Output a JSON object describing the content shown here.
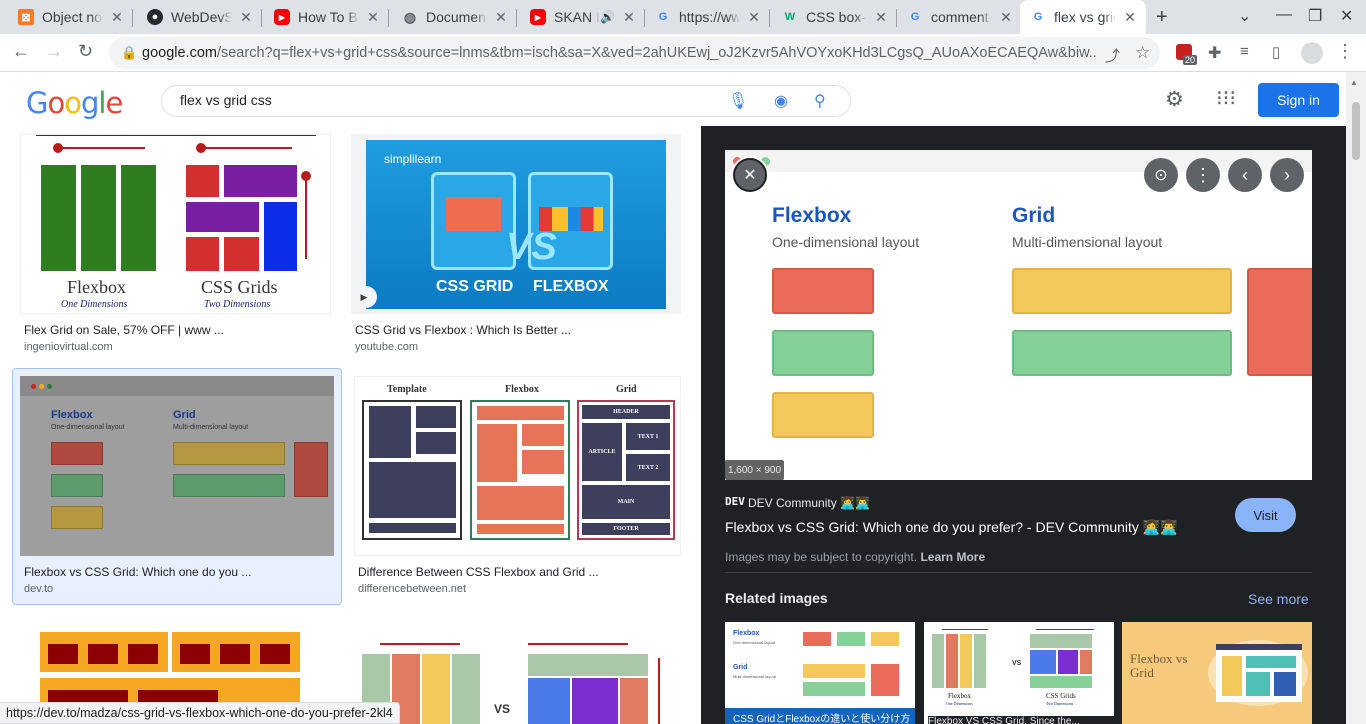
{
  "tabs": [
    {
      "title": "Object not found",
      "icon": "xampp-icon"
    },
    {
      "title": "WebDevSimplified",
      "icon": "github-icon"
    },
    {
      "title": "How To Build",
      "icon": "youtube-icon"
    },
    {
      "title": "Document",
      "icon": "globe-icon"
    },
    {
      "title": "SKAN I",
      "icon": "youtube-icon"
    },
    {
      "title": "https://www",
      "icon": "google-icon"
    },
    {
      "title": "CSS box-sh",
      "icon": "w3schools-icon"
    },
    {
      "title": "comment",
      "icon": "google-icon"
    },
    {
      "title": "flex vs grid",
      "icon": "google-icon"
    }
  ],
  "address": {
    "host": "google.com",
    "path": "/search?q=flex+vs+grid+css&source=lnms&tbm=isch&sa=X&ved=2ahUKEwj_oJ2Kzvr5AhVOYxoKHd3LCgsQ_AUoAXoECAEQAw&biw..."
  },
  "extension_badge": "20",
  "search": {
    "query": "flex vs grid css"
  },
  "header": {
    "signin": "Sign in"
  },
  "results": [
    {
      "caption": "Flex Grid on Sale, 57% OFF | www ...",
      "source": "ingeniovirtual.com",
      "thumb_text_1": "Flexbox",
      "thumb_sub_1": "One Dimensions",
      "thumb_text_2": "CSS Grids",
      "thumb_sub_2": "Two Dimensions"
    },
    {
      "caption": "CSS Grid vs Flexbox : Which Is Better ...",
      "source": "youtube.com",
      "brand": "simplilearn",
      "left_label": "CSS GRID",
      "right_label": "FLEXBOX",
      "vs": "VS"
    },
    {
      "caption": "Flexbox vs CSS Grid: Which one do you ...",
      "source": "dev.to",
      "h1": "Flexbox",
      "s1": "One-dimensional layout",
      "h2": "Grid",
      "s2": "Multi-dimensional layout"
    },
    {
      "caption": "Difference Between CSS Flexbox and Grid ...",
      "source": "differencebetween.net",
      "c1": "Template",
      "c2": "Flexbox",
      "c3": "Grid",
      "g1": "HEADER",
      "g2": "TEXT 1",
      "g3": "ARTICLE",
      "g4": "TEXT 2",
      "g5": "MAIN",
      "g6": "FOOTER"
    },
    {
      "vs": "VS"
    }
  ],
  "preview": {
    "h1": "Flexbox",
    "s1": "One-dimensional layout",
    "h2": "Grid",
    "s2": "Multi-dimensional layout",
    "dimensions": "1,600 × 900",
    "site_logo": "DEV",
    "site": "DEV Community 👩‍💻👨‍💻",
    "title": "Flexbox vs CSS Grid: Which one do you prefer? - DEV Community 👩‍💻👨‍💻",
    "visit": "Visit",
    "copyright": "Images may be subject to copyright.",
    "learn_more": "Learn More",
    "related": "Related images",
    "see_more": "See more",
    "rel1_h1": "Flexbox",
    "rel1_s1": "One-dimensional layout",
    "rel1_h2": "Grid",
    "rel1_s2": "Multi-dimensional layout",
    "rel1_caption": "CSS GridとFlexboxの違いと使い分け方",
    "rel2_l": "Flexbox",
    "rel2_ls": "One Dimensions",
    "rel2_r": "CSS Grids",
    "rel2_rs": "Two Dimensions",
    "rel2_vs": "VS",
    "rel2_caption": "Flexbox VS CSS Grid. Since the...",
    "rel3_text": "Flexbox vs Grid"
  },
  "status_url": "https://dev.to/madza/css-grid-vs-flexbox-which-one-do-you-prefer-2kl4",
  "colors": {
    "google_blue": "#1a73e8",
    "panel_bg": "#202124",
    "red": "#eb6b5b",
    "green": "#86d19a",
    "yellow": "#f3c95b",
    "highlight": "#e8f0fe"
  }
}
